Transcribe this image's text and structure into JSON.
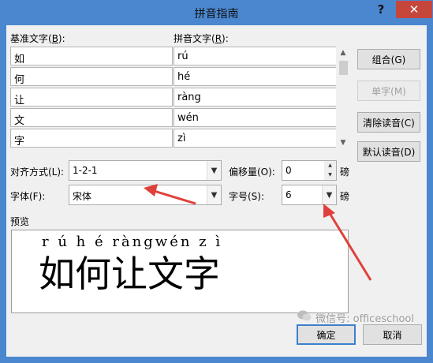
{
  "dialog": {
    "title": "拼音指南",
    "help_glyph": "?",
    "close_glyph": "✕"
  },
  "columns": {
    "base_label": "基准文字(",
    "base_key": "B",
    "base_suffix": "):",
    "pinyin_label": "拼音文字(",
    "pinyin_key": "R",
    "pinyin_suffix": "):"
  },
  "rows": [
    {
      "base": "如",
      "pinyin": "rú"
    },
    {
      "base": "何",
      "pinyin": "hé"
    },
    {
      "base": "让",
      "pinyin": "ràng"
    },
    {
      "base": "文",
      "pinyin": "wén"
    },
    {
      "base": "字",
      "pinyin": "zì"
    }
  ],
  "buttons": {
    "group": "组合(G)",
    "single": "单字(M)",
    "clear": "清除读音(C)",
    "default_reading": "默认读音(D)",
    "ok": "确定",
    "cancel": "取消"
  },
  "alignment": {
    "label": "对齐方式(L):",
    "value": "1-2-1"
  },
  "offset": {
    "label": "偏移量(O):",
    "value": "0",
    "unit": "磅"
  },
  "font": {
    "label": "字体(F):",
    "value": "宋体"
  },
  "size": {
    "label": "字号(S):",
    "value": "6",
    "unit": "磅"
  },
  "preview": {
    "label": "预览",
    "ruby_text": "r ú  h é ràngwén z ì",
    "base_text": "如何让文字"
  },
  "watermark": "微信号: officeschool",
  "colors": {
    "titlebar": "#4a87cf",
    "close": "#c7463c",
    "arrow": "#e0403b",
    "default_border": "#3c7fd0"
  },
  "icons": [
    "help-icon",
    "close-icon",
    "dropdown-icon",
    "spin-up-icon",
    "spin-down-icon",
    "scroll-up-icon",
    "scroll-down-icon",
    "wechat-icon"
  ]
}
